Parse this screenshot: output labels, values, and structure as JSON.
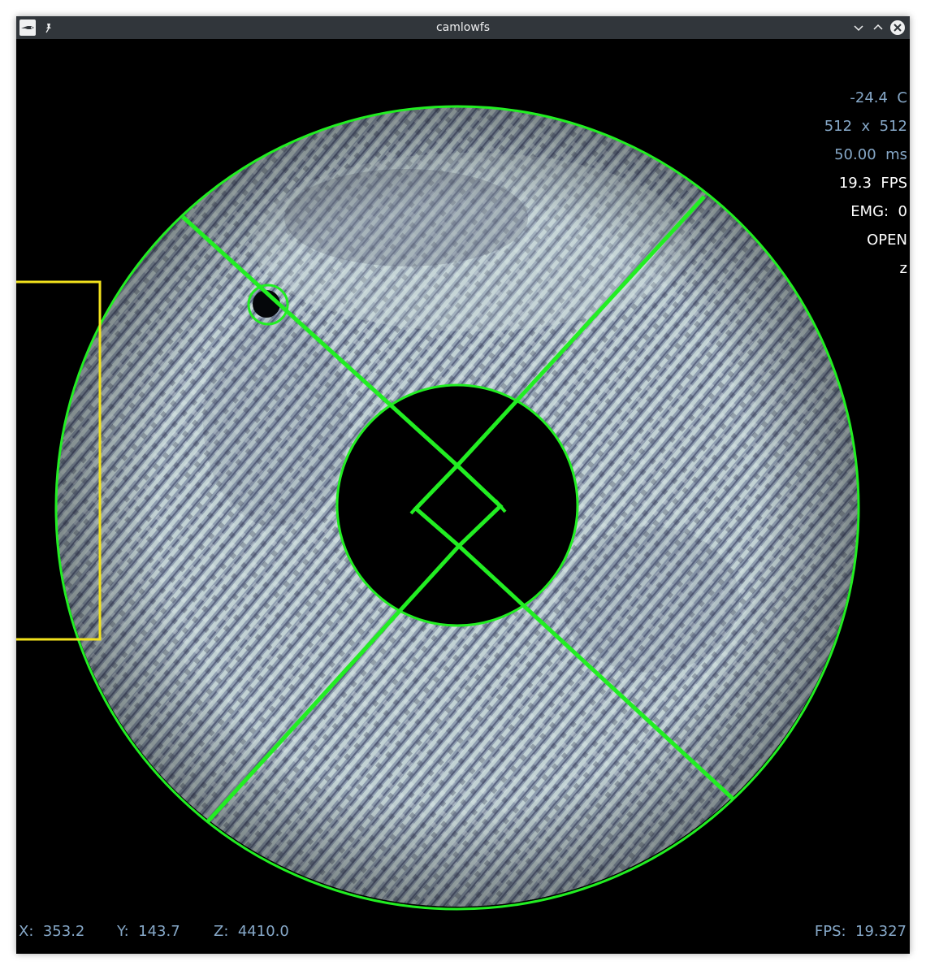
{
  "window": {
    "title": "camlowfs",
    "app_icon": "camlowfs-app-icon",
    "buttons": {
      "pin": "pin-icon",
      "minimize": "chevron-down-icon",
      "maximize": "chevron-up-icon",
      "close": "close-icon"
    }
  },
  "status_panel": {
    "temperature": "-24.4  C",
    "resolution": "512  x  512",
    "exposure": "50.00  ms",
    "fps": "19.3  FPS",
    "emg": "EMG:  0",
    "shutter": "OPEN",
    "scale": "z"
  },
  "cursor_readout": {
    "x": "X:  353.2",
    "y": "Y:  143.7",
    "z": "Z:  4410.0",
    "fps": "FPS:  19.327"
  },
  "colors": {
    "overlay_green": "#22ee22",
    "roi_yellow": "#f2e21c",
    "status_blue": "#86a8c8",
    "status_white": "#ffffff",
    "titlebar": "#31363b",
    "pupil_light": "#b4c6c8",
    "pupil_dark": "#3c4258"
  }
}
